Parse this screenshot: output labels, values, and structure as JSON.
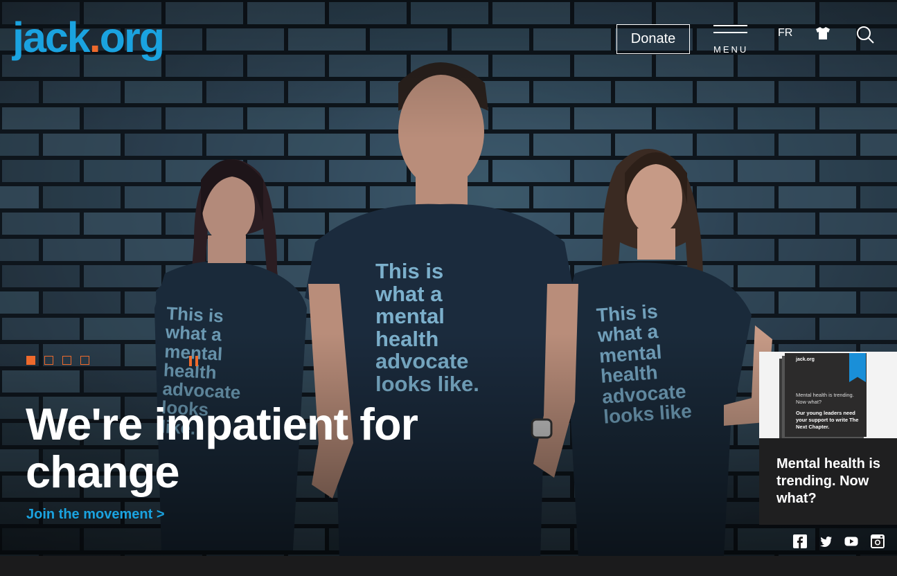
{
  "header": {
    "logo_main": "jack",
    "logo_dot": ".",
    "logo_tld": "org",
    "donate_label": "Donate",
    "menu_label": "MENU",
    "language_label": "FR",
    "shop_icon": "tshirt-icon",
    "search_icon": "search-icon"
  },
  "hero": {
    "headline": "We're impatient for change",
    "cta_label": "Join the movement >",
    "slides": [
      {
        "active": true
      },
      {
        "active": false
      },
      {
        "active": false
      },
      {
        "active": false
      }
    ],
    "pause_icon": "pause-icon",
    "shirt_text": {
      "center": "This is what a mental health advocate looks like.",
      "brand": "jack.org"
    }
  },
  "promo": {
    "book_brand": "jack.org",
    "book_line1": "Mental health is trending. Now what?",
    "book_line2": "Our young leaders need your support to write The Next Chapter.",
    "title": "Mental health is trending. Now what?"
  },
  "social": [
    {
      "name": "facebook-icon"
    },
    {
      "name": "twitter-icon"
    },
    {
      "name": "youtube-icon"
    },
    {
      "name": "instagram-icon"
    }
  ],
  "colors": {
    "brand_blue": "#1aa3e0",
    "accent_orange": "#ee6a2c",
    "dark_bg": "#1b1b1c"
  }
}
